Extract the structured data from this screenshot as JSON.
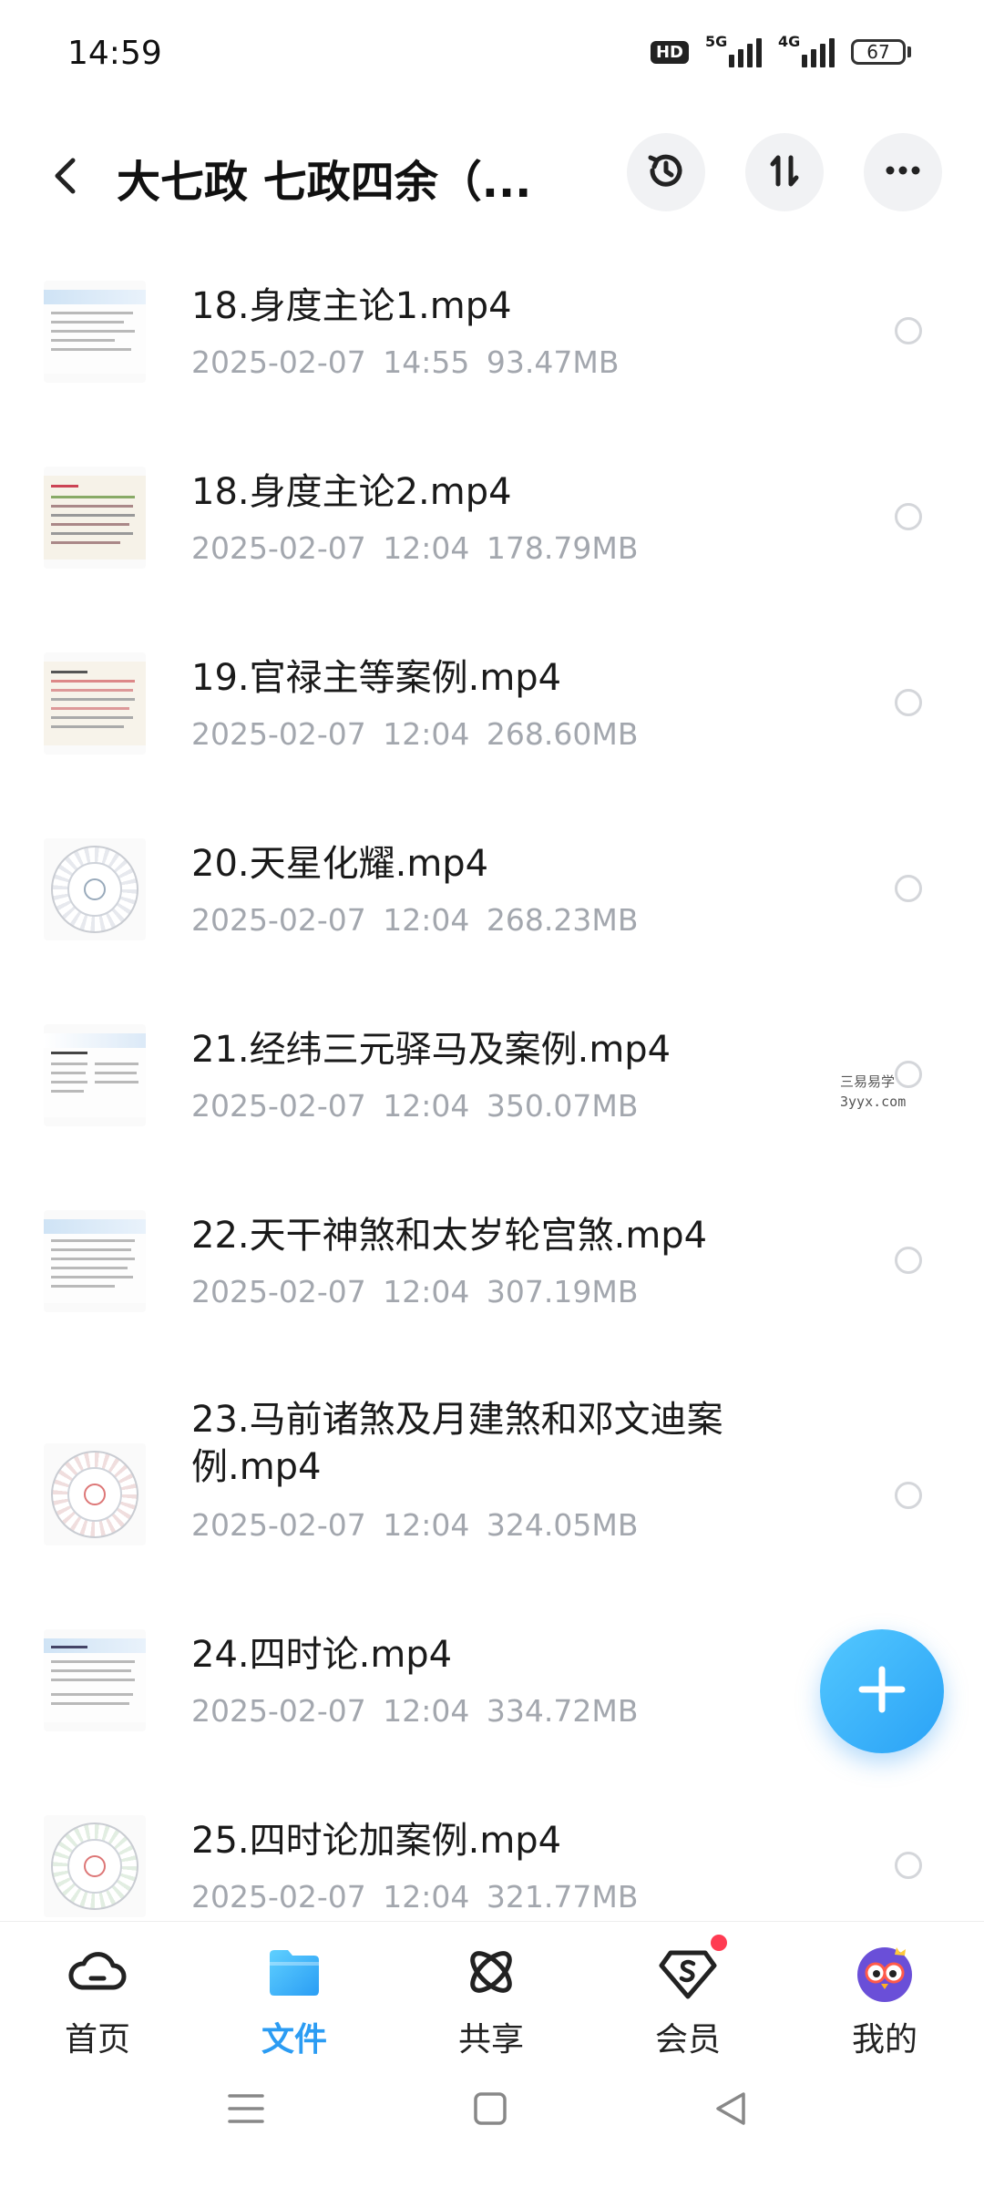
{
  "status_bar": {
    "time": "14:59",
    "hd_label": "HD",
    "signal1_label": "5G",
    "signal2_label": "4G",
    "battery": "67"
  },
  "header": {
    "title": "大七政 七政四余（...",
    "icons": [
      "back-icon",
      "history-icon",
      "sort-icon",
      "more-icon"
    ]
  },
  "files": [
    {
      "name": "18.身度主论1.mp4",
      "date": "2025-02-07",
      "time": "14:55",
      "size": "93.47MB"
    },
    {
      "name": "18.身度主论2.mp4",
      "date": "2025-02-07",
      "time": "12:04",
      "size": "178.79MB"
    },
    {
      "name": "19.官禄主等案例.mp4",
      "date": "2025-02-07",
      "time": "12:04",
      "size": "268.60MB"
    },
    {
      "name": "20.天星化耀.mp4",
      "date": "2025-02-07",
      "time": "12:04",
      "size": "268.23MB"
    },
    {
      "name": "21.经纬三元驿马及案例.mp4",
      "date": "2025-02-07",
      "time": "12:04",
      "size": "350.07MB"
    },
    {
      "name": "22.天干神煞和太岁轮宫煞.mp4",
      "date": "2025-02-07",
      "time": "12:04",
      "size": "307.19MB"
    },
    {
      "name": "23.马前诸煞及月建煞和邓文迪案例.mp4",
      "date": "2025-02-07",
      "time": "12:04",
      "size": "324.05MB"
    },
    {
      "name": "24.四时论.mp4",
      "date": "2025-02-07",
      "time": "12:04",
      "size": "334.72MB"
    },
    {
      "name": "25.四时论加案例.mp4",
      "date": "2025-02-07",
      "time": "12:04",
      "size": "321.77MB"
    }
  ],
  "watermark": {
    "line1": "三易易学",
    "line2": "3yyx.com"
  },
  "tabs": [
    {
      "label": "首页",
      "icon": "cloud-home-icon"
    },
    {
      "label": "文件",
      "icon": "folder-icon"
    },
    {
      "label": "共享",
      "icon": "share-atom-icon"
    },
    {
      "label": "会员",
      "icon": "vip-diamond-icon"
    },
    {
      "label": "我的",
      "icon": "owl-avatar-icon"
    }
  ],
  "active_tab": "文件",
  "colors": {
    "accent": "#2b9cf3",
    "meta_text": "#a3a7ae",
    "badge": "#ff3b52"
  }
}
